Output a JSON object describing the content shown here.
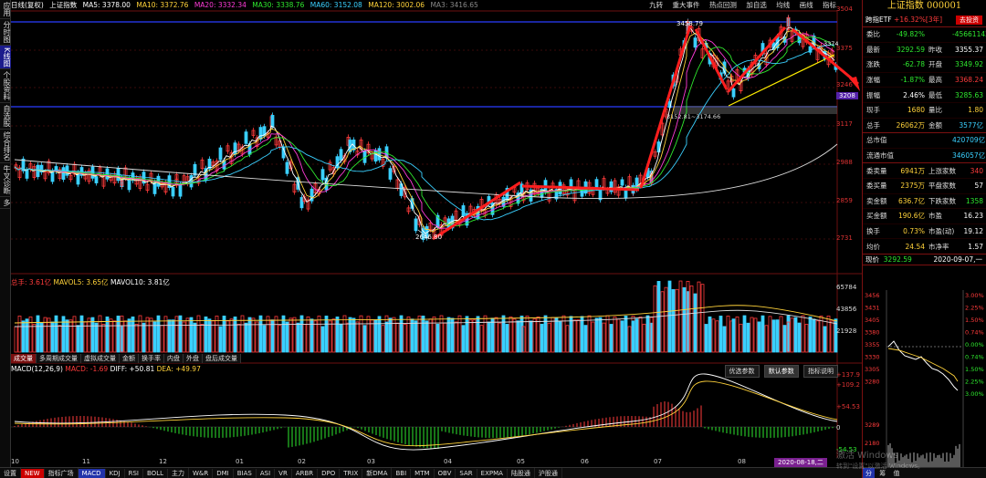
{
  "left_tabs": [
    "应用",
    "分时图",
    "K线图",
    "个股资料",
    "自选股",
    "综合排名",
    "牛叉诊断",
    "多"
  ],
  "main_title": {
    "name": "日线(复权)",
    "index": "上证指数",
    "ma": [
      {
        "label": "MA5: 3378.00",
        "color": "#ffffff"
      },
      {
        "label": "MA10: 3372.76",
        "color": "#ffd23a"
      },
      {
        "label": "MA20: 3332.34",
        "color": "#ff3bd8"
      },
      {
        "label": "MA30: 3338.76",
        "color": "#2ee82e"
      },
      {
        "label": "MA60: 3152.08",
        "color": "#3ad0ff"
      },
      {
        "label": "MA120: 3002.06",
        "color": "#ffd23a"
      },
      {
        "label": "MA3: 3416.65",
        "color": "#888888"
      }
    ]
  },
  "top_tools": [
    "九转",
    "重大事件",
    "热点回测",
    "加自选",
    "均线",
    "画线",
    "指标"
  ],
  "price_axis": [
    "3504",
    "3375",
    "3246",
    "3117",
    "2988",
    "2859",
    "2731"
  ],
  "price_annotations": {
    "high": "3458.79",
    "low": "2646.80",
    "mid": "3152.81~3174.66",
    "box": "3208",
    "level": "3374"
  },
  "volume": {
    "title": "总手: 3.61亿",
    "mavol5": "MAVOL5: 3.65亿",
    "mavol10": "MAVOL10: 3.81亿",
    "axis": [
      "65784",
      "43856",
      "21928"
    ]
  },
  "sub_tabs": [
    "成交量",
    "多周期成交量",
    "虚拟成交量",
    "金额",
    "换手率",
    "内盘",
    "外盘",
    "盘后成交量"
  ],
  "macd": {
    "title": "MACD(12,26,9)",
    "macd": "MACD: -1.69",
    "diff": "DIFF: +50.81",
    "dea": "DEA: +49.97",
    "axis": [
      "+137.9",
      "+109.2",
      "+54.53",
      "0",
      "-54.53"
    ],
    "buttons": [
      "优选参数",
      "默认参数",
      "指标说明"
    ]
  },
  "x_axis": [
    "10",
    "11",
    "12",
    "01",
    "02",
    "03",
    "04",
    "05",
    "06",
    "07",
    "08"
  ],
  "date_badge": "2020-08-18,二",
  "bottom_tabs": [
    "设置",
    "NEW",
    "指标广场",
    "MACD",
    "KDJ",
    "RSI",
    "BOLL",
    "主力",
    "W&R",
    "DMI",
    "BIAS",
    "ASI",
    "VR",
    "ARBR",
    "DPO",
    "TRIX",
    "新DMA",
    "BBI",
    "MTM",
    "OBV",
    "SAR",
    "EXPMA",
    "陆股通",
    "沪股通"
  ],
  "right_panel": {
    "title": "上证指数 000001",
    "etf_label": "跨指ETF",
    "etf_value": "+16.32%[3年]",
    "etf_button": "去投资",
    "rows": [
      {
        "l1": "委比",
        "v1": "-49.82%",
        "c1": "green",
        "l2": "",
        "v2": "-45661142",
        "c2": "green"
      },
      {
        "l1": "最新",
        "v1": "3292.59",
        "c1": "green",
        "l2": "昨收",
        "v2": "3355.37",
        "c2": "white"
      },
      {
        "l1": "涨跌",
        "v1": "-62.78",
        "c1": "green",
        "l2": "开盘",
        "v2": "3349.92",
        "c2": "green"
      },
      {
        "l1": "涨幅",
        "v1": "-1.87%",
        "c1": "green",
        "l2": "最高",
        "v2": "3368.24",
        "c2": "red"
      },
      {
        "l1": "振幅",
        "v1": "2.46%",
        "c1": "white",
        "l2": "最低",
        "v2": "3285.63",
        "c2": "green"
      },
      {
        "l1": "现手",
        "v1": "1680",
        "c1": "yellow",
        "l2": "量比",
        "v2": "1.80",
        "c2": "yellow"
      },
      {
        "l1": "总手",
        "v1": "26062万",
        "c1": "yellow",
        "l2": "金额",
        "v2": "3577亿",
        "c2": "cyan"
      },
      {
        "l1": "总市值",
        "v1": "",
        "c1": "white",
        "l2": "",
        "v2": "420709亿",
        "c2": "cyan"
      },
      {
        "l1": "流通市值",
        "v1": "",
        "c1": "white",
        "l2": "",
        "v2": "346057亿",
        "c2": "cyan"
      },
      {
        "l1": "委卖量",
        "v1": "6941万",
        "c1": "yellow",
        "l2": "上涨家数",
        "v2": "340",
        "c2": "red"
      },
      {
        "l1": "委买量",
        "v1": "2375万",
        "c1": "yellow",
        "l2": "平盘家数",
        "v2": "57",
        "c2": "white"
      },
      {
        "l1": "卖金额",
        "v1": "636.7亿",
        "c1": "yellow",
        "l2": "下跌家数",
        "v2": "1358",
        "c2": "green"
      },
      {
        "l1": "买金额",
        "v1": "190.6亿",
        "c1": "yellow",
        "l2": "市盈",
        "v2": "16.23",
        "c2": "white"
      },
      {
        "l1": "换手",
        "v1": "0.73%",
        "c1": "yellow",
        "l2": "市盈(动)",
        "v2": "19.12",
        "c2": "white"
      },
      {
        "l1": "均价",
        "v1": "24.54",
        "c1": "yellow",
        "l2": "市净率",
        "v2": "1.57",
        "c2": "white"
      }
    ],
    "mini_head": {
      "label": "现价",
      "price": "3292.59",
      "date": "2020-09-07,一"
    },
    "mini_left_axis": [
      "3456",
      "3431",
      "3405",
      "3380",
      "3355",
      "3330",
      "3305",
      "3280",
      "3289",
      "2180"
    ],
    "mini_right_axis": [
      "3.00%",
      "2.25%",
      "1.50%",
      "0.74%",
      "0.00%",
      "0.74%",
      "1.50%",
      "2.25%",
      "3.00%"
    ],
    "bottom_tabs": [
      "分",
      "筹",
      "值"
    ]
  },
  "watermark": "激活 Windows",
  "watermark_sub": "转到\"设置\"以激活 Windows。"
}
